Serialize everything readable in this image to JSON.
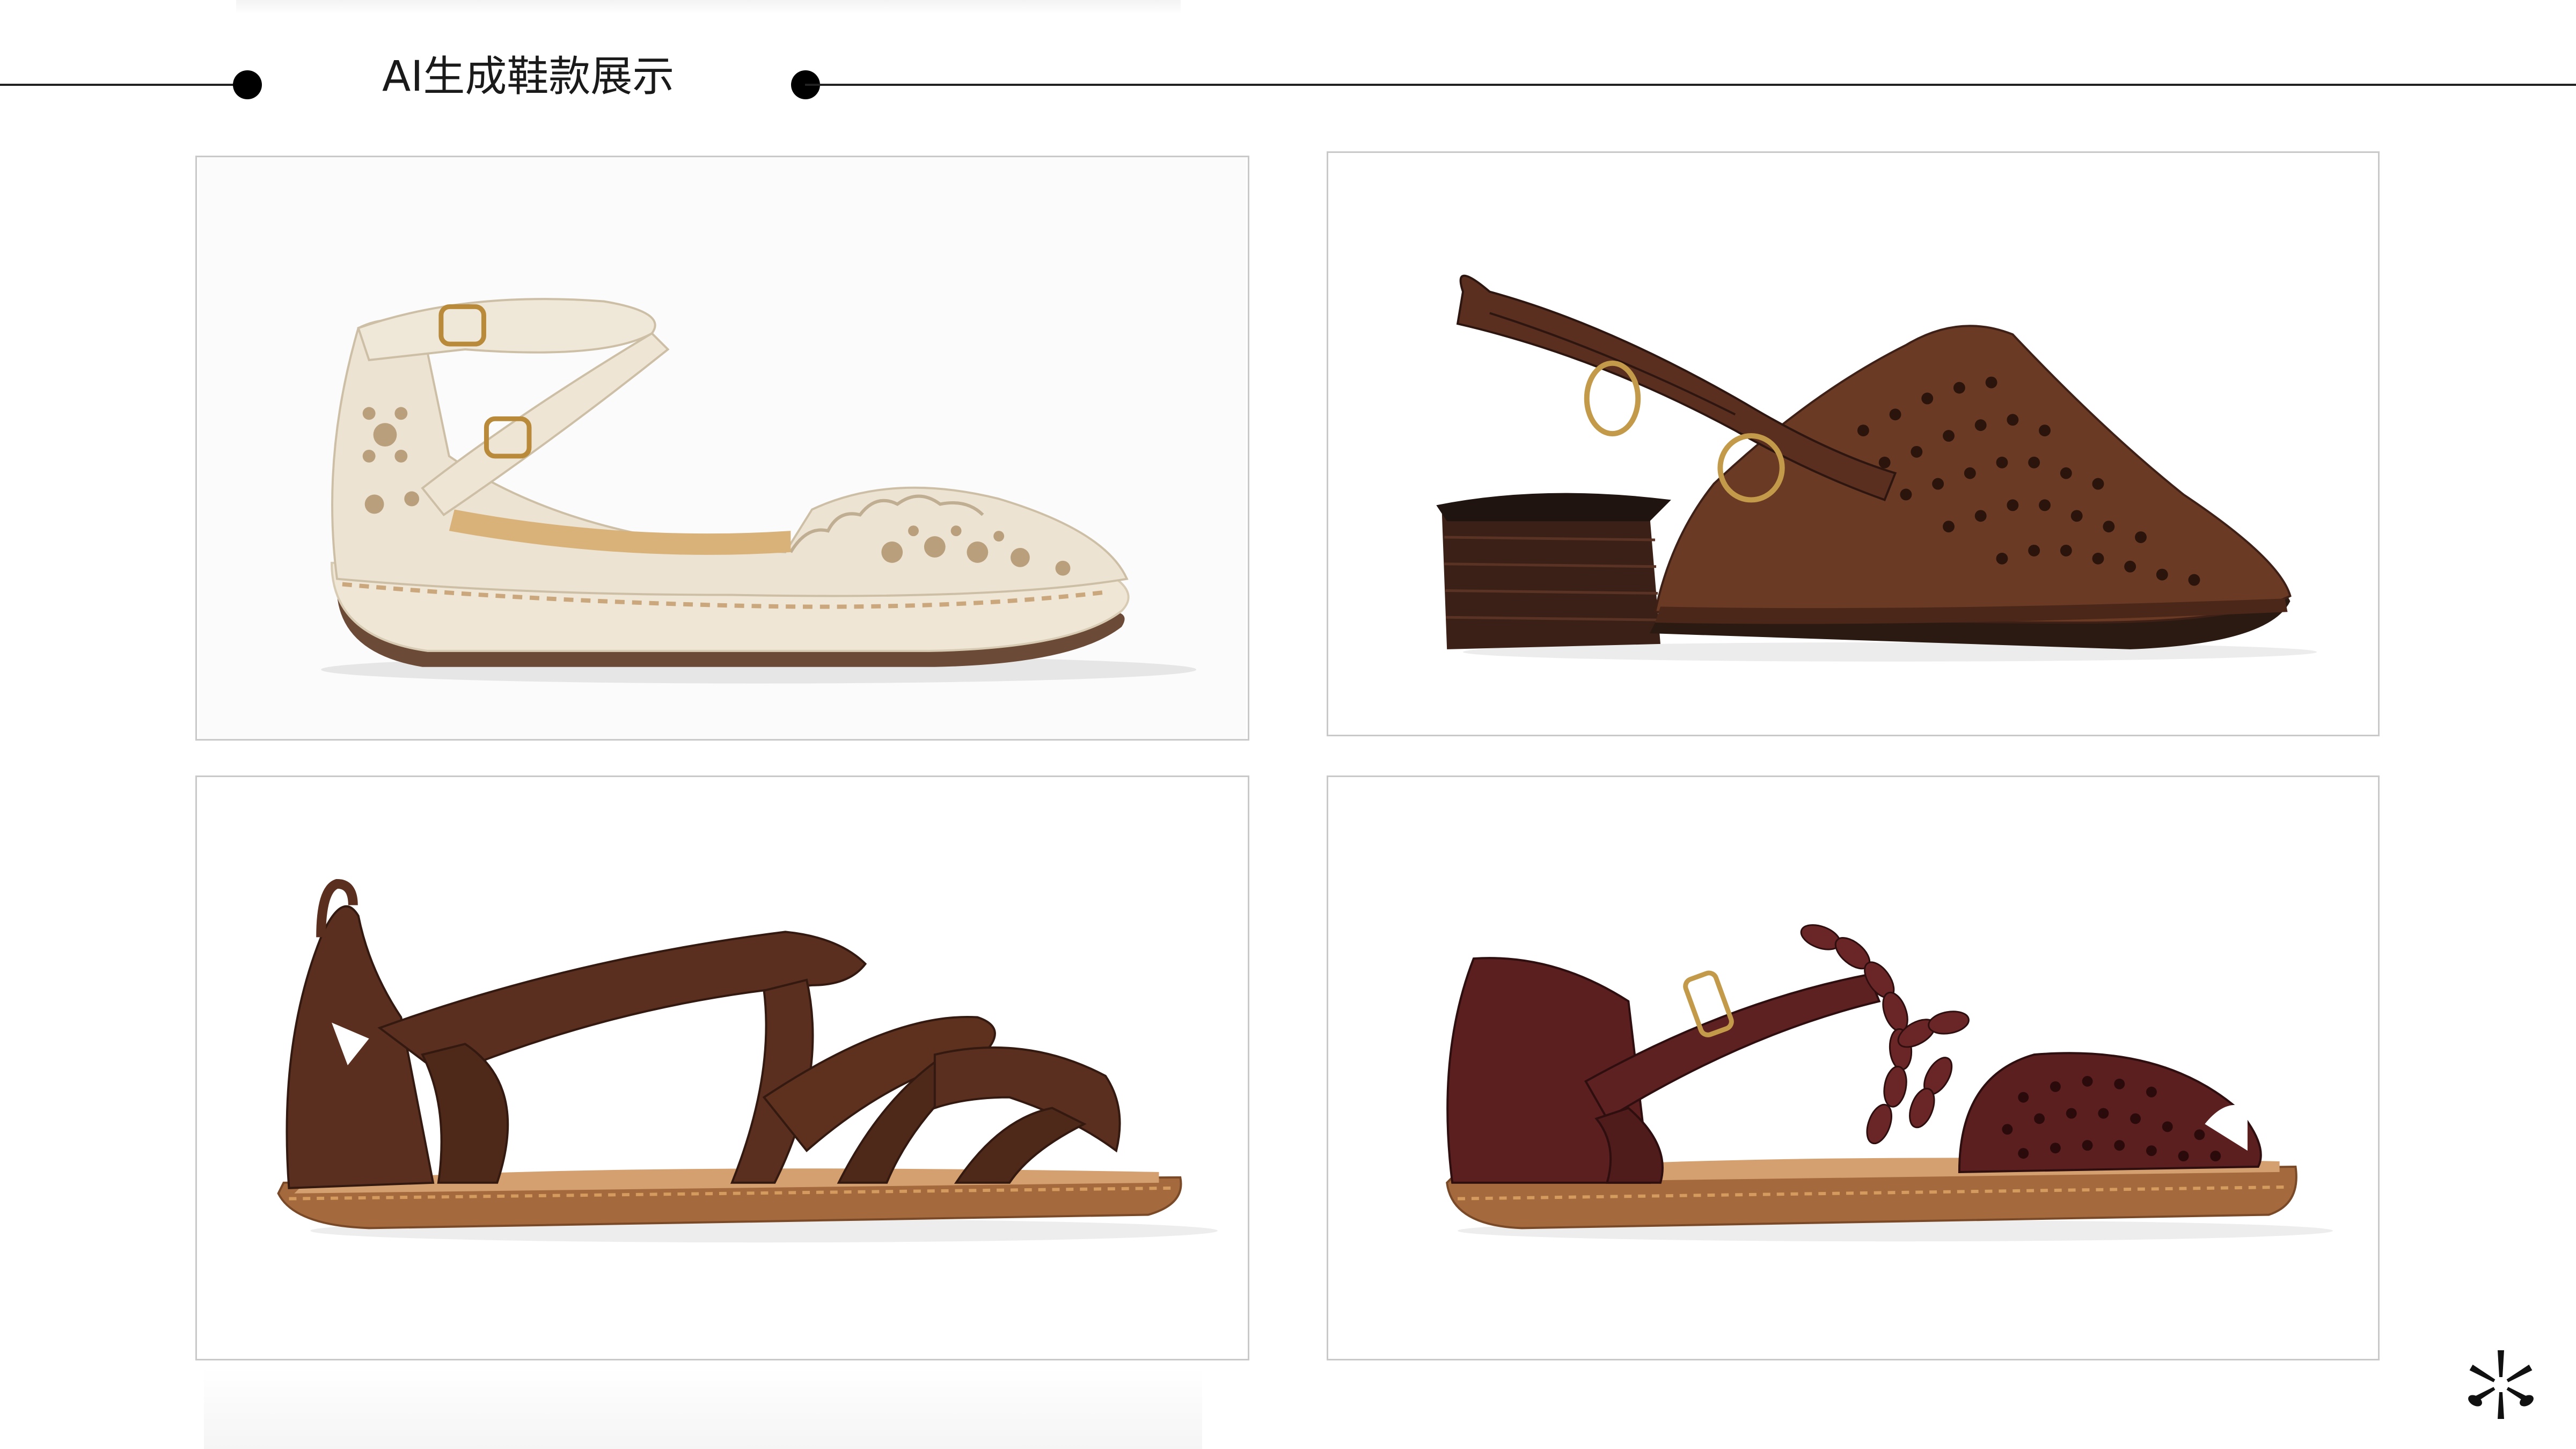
{
  "header": {
    "title": "AI生成鞋款展示"
  },
  "gallery": {
    "items": [
      {
        "icon": "cream-perforated-ankle-strap-flat-image"
      },
      {
        "icon": "brown-perforated-slingback-mule-image"
      },
      {
        "icon": "brown-woven-strap-fisherman-sandal-image"
      },
      {
        "icon": "burgundy-braided-strap-fisherman-sandal-image"
      }
    ]
  },
  "brand": {
    "icon": "starburst-logo-icon"
  },
  "colors": {
    "line": "#222222",
    "frame_border": "#c9c9c9",
    "cream_leather": "#ece3d2",
    "brown_leather": "#5a2f1f",
    "dark_brown_leather": "#4a2418",
    "burgundy_leather": "#5b1f1f",
    "sole_tan": "#a46a3e"
  }
}
